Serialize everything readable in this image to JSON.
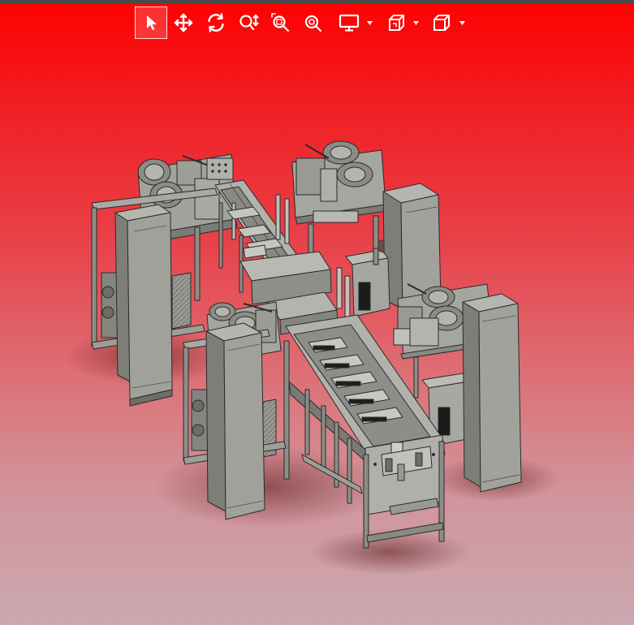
{
  "viewer": {
    "tools": [
      {
        "id": "select",
        "icon": "select-arrow-icon",
        "active": true
      },
      {
        "id": "pan",
        "icon": "move-arrows-icon"
      },
      {
        "id": "rotate",
        "icon": "rotate-icon"
      },
      {
        "id": "zoom",
        "icon": "zoom-updown-icon"
      },
      {
        "id": "zoom-window",
        "icon": "zoom-window-icon"
      },
      {
        "id": "zoom-fit",
        "icon": "zoom-fit-icon"
      },
      {
        "id": "display",
        "icon": "monitor-icon",
        "dropdown": true
      },
      {
        "id": "section",
        "icon": "section-view-icon",
        "dropdown": true
      },
      {
        "id": "view-orientation",
        "icon": "cube-view-icon",
        "dropdown": true
      }
    ],
    "colors": {
      "background_top": "#ff0000",
      "background_bottom": "#cba8b0",
      "model_face": "#9e9e98",
      "model_light": "#b4b4ae",
      "model_dark": "#6e6e68",
      "model_edge": "#2a2a2a"
    },
    "model": {
      "description_icon": "assembly-line-machine"
    }
  }
}
